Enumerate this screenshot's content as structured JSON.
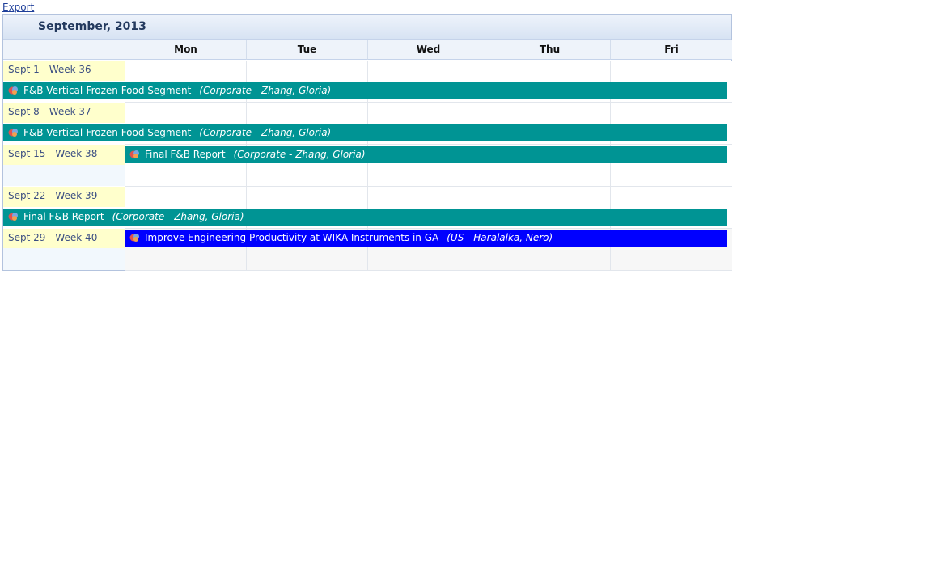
{
  "export_label": "Export",
  "calendar": {
    "title": "September, 2013",
    "days": [
      "Mon",
      "Tue",
      "Wed",
      "Thu",
      "Fri"
    ],
    "weeks": [
      {
        "label": "Sept 1 - Week 36"
      },
      {
        "label": "Sept 8 - Week 37"
      },
      {
        "label": "Sept 15 - Week 38"
      },
      {
        "label": "Sept 22 - Week 39"
      },
      {
        "label": "Sept 29 - Week 40"
      }
    ],
    "events": [
      {
        "title": "F&B Vertical-Frozen Food Segment",
        "owner": "(Corporate - Zhang, Gloria)",
        "color": "#009494"
      },
      {
        "title": "F&B Vertical-Frozen Food Segment",
        "owner": "(Corporate - Zhang, Gloria)",
        "color": "#009494"
      },
      {
        "title": "Final F&B Report",
        "owner": "(Corporate - Zhang, Gloria)",
        "color": "#009494"
      },
      {
        "title": "Final F&B Report",
        "owner": "(Corporate - Zhang, Gloria)",
        "color": "#009494"
      },
      {
        "title": "Improve Engineering Productivity at WIKA Instruments in GA",
        "owner": "(US - Haralalka, Nero)",
        "color": "#0000ff"
      }
    ]
  }
}
